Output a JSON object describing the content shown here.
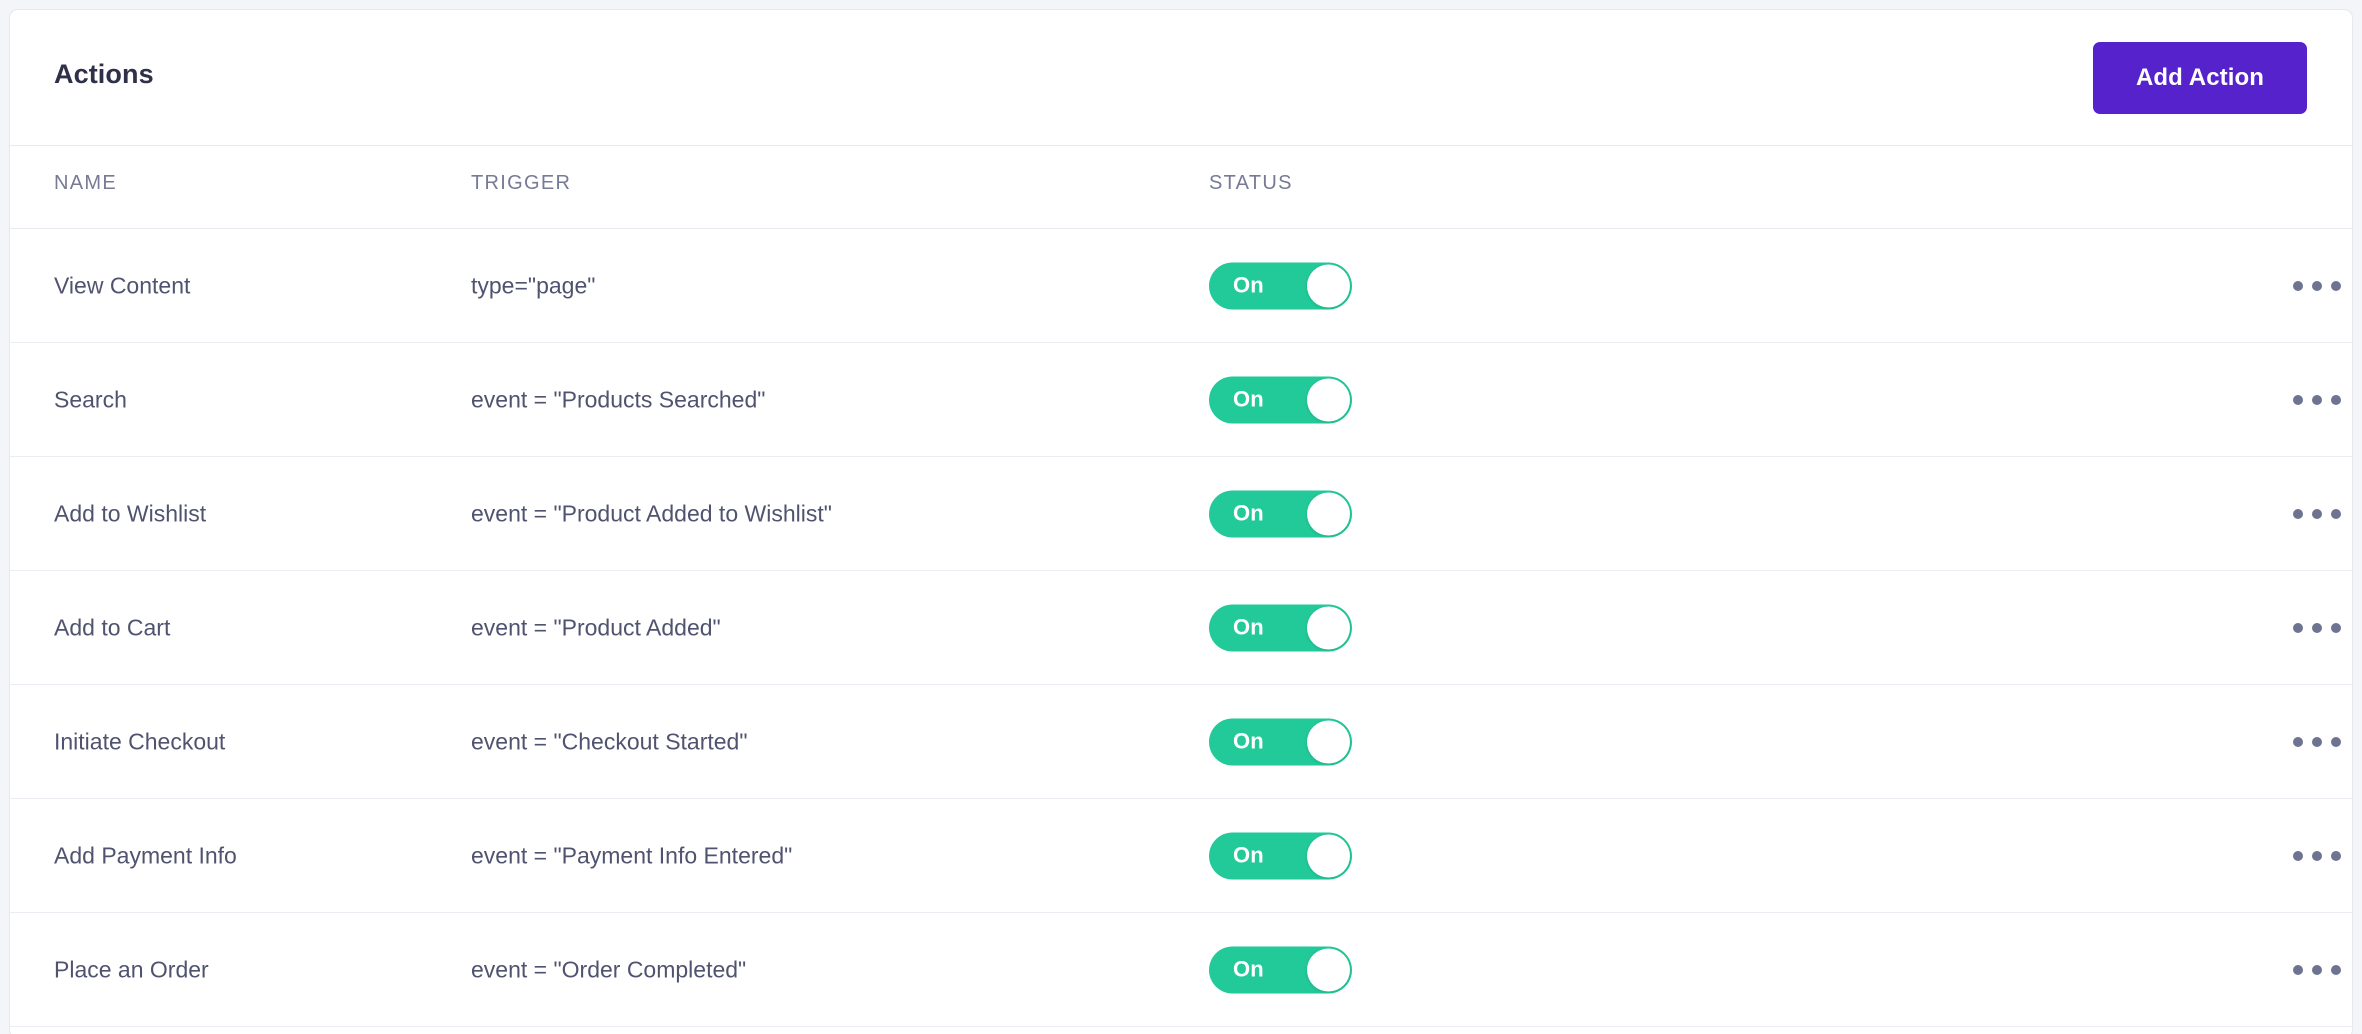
{
  "card": {
    "title": "Actions",
    "add_button_label": "Add Action"
  },
  "table": {
    "columns": {
      "name": "NAME",
      "trigger": "TRIGGER",
      "status": "STATUS"
    },
    "rows": [
      {
        "name": "View Content",
        "trigger": "type=\"page\"",
        "status": "On",
        "menu_icon": "ellipsis-horizontal-icon"
      },
      {
        "name": "Search",
        "trigger": "event = \"Products Searched\"",
        "status": "On",
        "menu_icon": "ellipsis-horizontal-icon"
      },
      {
        "name": "Add to Wishlist",
        "trigger": "event = \"Product Added to Wishlist\"",
        "status": "On",
        "menu_icon": "ellipsis-horizontal-icon"
      },
      {
        "name": "Add to Cart",
        "trigger": "event = \"Product Added\"",
        "status": "On",
        "menu_icon": "ellipsis-horizontal-icon"
      },
      {
        "name": "Initiate Checkout",
        "trigger": "event = \"Checkout Started\"",
        "status": "On",
        "menu_icon": "ellipsis-horizontal-icon"
      },
      {
        "name": "Add Payment Info",
        "trigger": "event = \"Payment Info Entered\"",
        "status": "On",
        "menu_icon": "ellipsis-horizontal-icon"
      },
      {
        "name": "Place an Order",
        "trigger": "event = \"Order Completed\"",
        "status": "On",
        "menu_icon": "ellipsis-horizontal-icon"
      }
    ]
  },
  "colors": {
    "accent_purple": "#5522cc",
    "toggle_on_green": "#22c999",
    "page_background": "#f4f5f9",
    "text_primary": "#2f3049",
    "text_body": "#50536f",
    "text_muted": "#767a95",
    "border": "#e9eaf1"
  }
}
